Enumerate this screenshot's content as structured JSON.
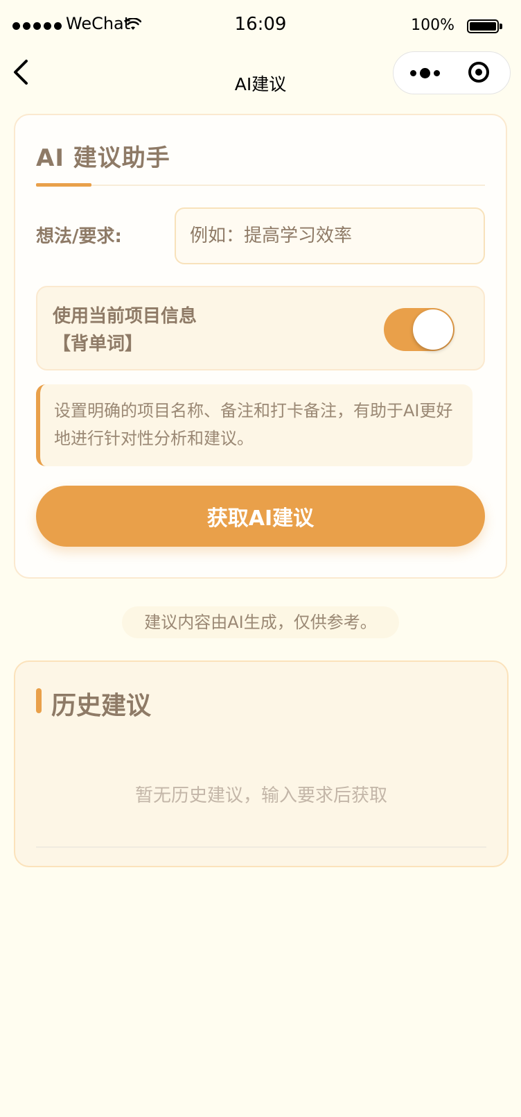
{
  "status_bar": {
    "carrier": "WeChat",
    "time": "16:09",
    "battery": "100%"
  },
  "nav": {
    "title": "AI建议",
    "icons": [
      "back-icon",
      "more-icon",
      "close-mini-program-icon"
    ]
  },
  "assistant": {
    "title": "AI 建议助手",
    "field_label": "想法/要求:",
    "input_placeholder": "例如：提高学习效率",
    "input_value": "",
    "toggle_label": "使用当前项目信息",
    "toggle_project": "【背单词】",
    "toggle_on": true,
    "hint": "设置明确的项目名称、备注和打卡备注，有助于AI更好地进行针对性分析和建议。",
    "button": "获取AI建议"
  },
  "disclaimer": "建议内容由AI生成，仅供参考。",
  "history": {
    "title": "历史建议",
    "empty": "暂无历史建议，输入要求后获取"
  },
  "colors": {
    "background": "#fffdf0",
    "accent": "#e9a04a",
    "text_muted": "#8e7a66"
  }
}
